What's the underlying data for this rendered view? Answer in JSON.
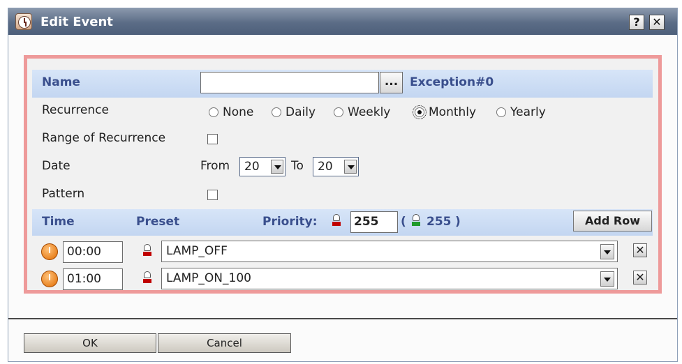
{
  "window": {
    "title": "Edit Event",
    "help_label": "?",
    "close_label": "✕"
  },
  "form": {
    "name": {
      "label": "Name",
      "value": "",
      "browse_label": "...",
      "exception": "Exception#0"
    },
    "recurrence": {
      "label": "Recurrence",
      "options": [
        "None",
        "Daily",
        "Weekly",
        "Monthly",
        "Yearly"
      ],
      "selected": "Monthly"
    },
    "range": {
      "label": "Range of Recurrence",
      "checked": false
    },
    "date": {
      "label": "Date",
      "from_label": "From",
      "from_value": "20",
      "to_label": "To",
      "to_value": "20"
    },
    "pattern": {
      "label": "Pattern",
      "checked": false
    }
  },
  "schedule": {
    "headers": {
      "time": "Time",
      "preset": "Preset",
      "priority": "Priority:"
    },
    "priority_value": "255",
    "priority_effective": "255",
    "paren_open": "(",
    "paren_close": ")",
    "add_row_label": "Add Row",
    "rows": [
      {
        "time": "00:00",
        "preset": "LAMP_OFF"
      },
      {
        "time": "01:00",
        "preset": "LAMP_ON_100"
      }
    ]
  },
  "footer": {
    "ok_label": "OK",
    "cancel_label": "Cancel"
  },
  "colors": {
    "title_bar": "#5b6c86",
    "header_text": "#3a4f8d",
    "frame": "#ee9a9a",
    "row_header": "#c9dbf3"
  },
  "icons": {
    "title": "clock-icon",
    "time": "clock-icon",
    "preset": "lamp-off-icon",
    "priority": "lamp-icon"
  }
}
